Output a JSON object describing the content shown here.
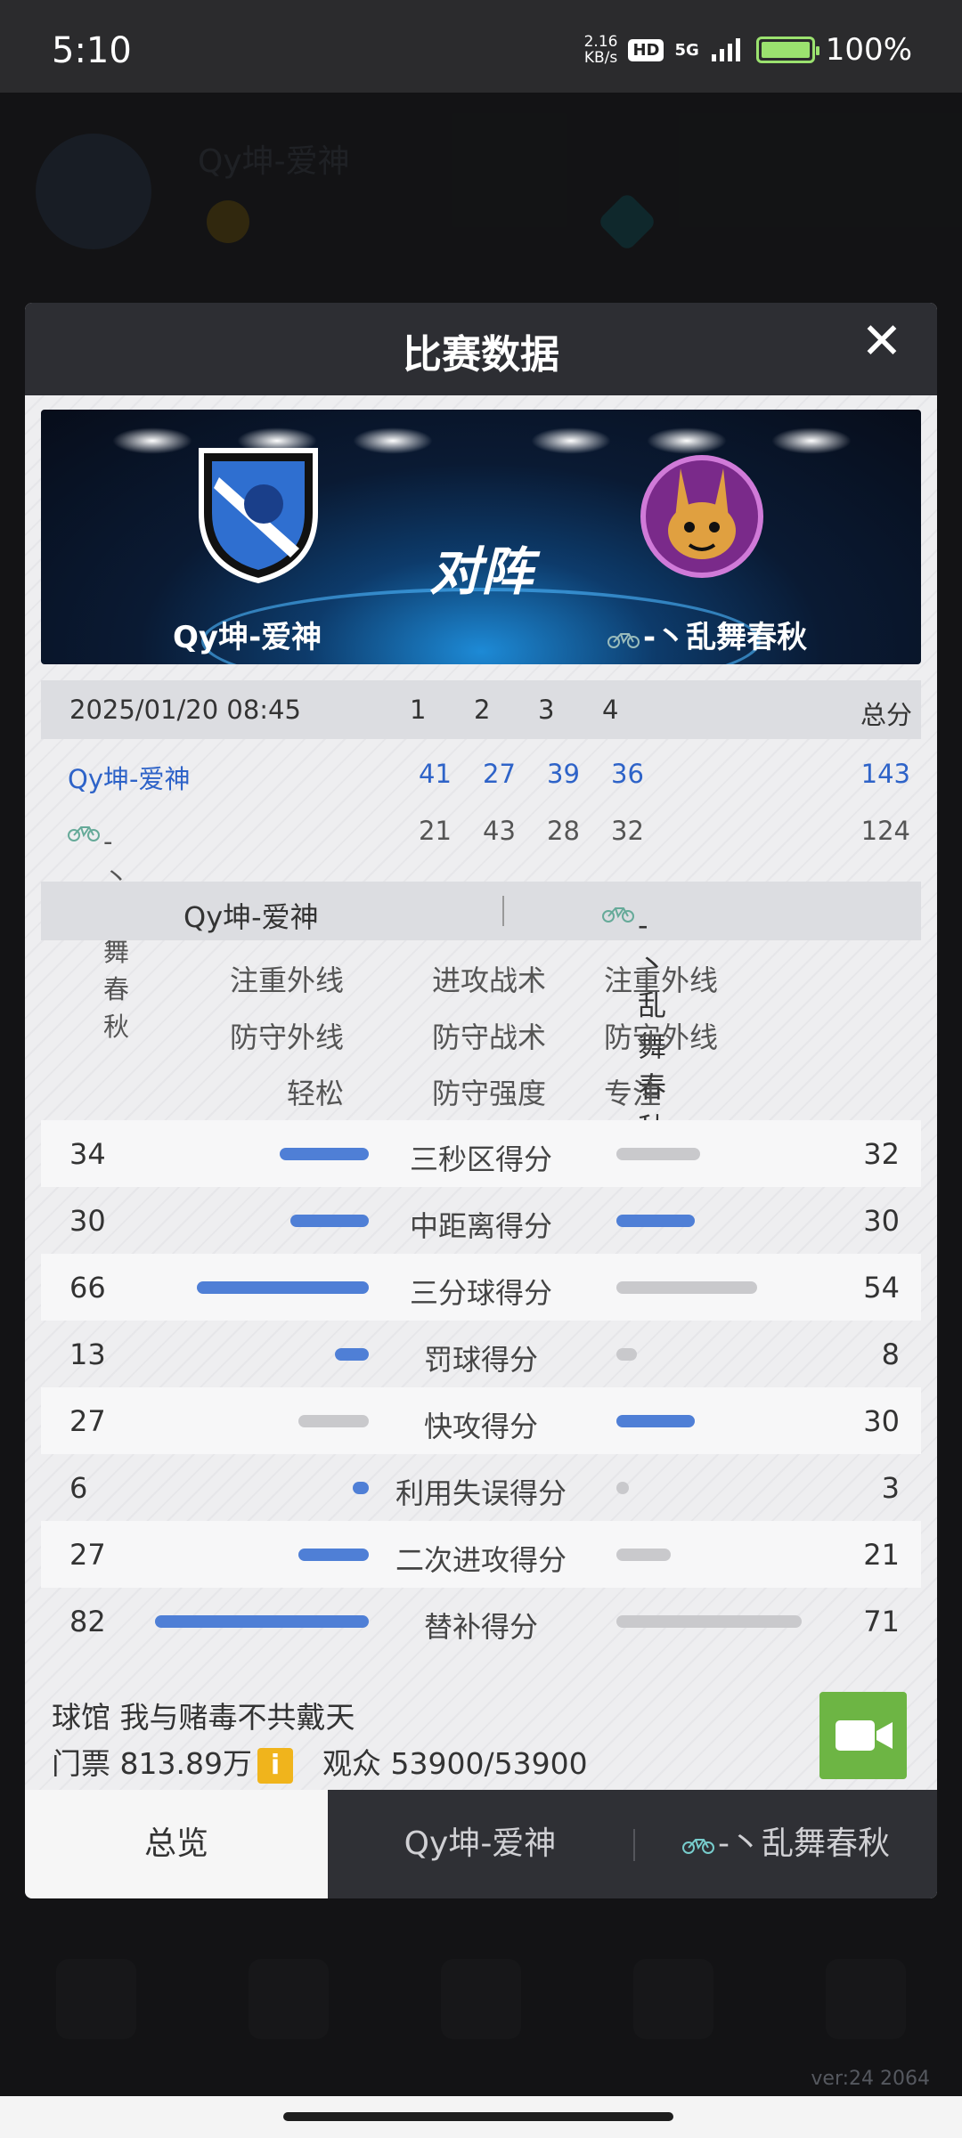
{
  "status_bar": {
    "time": "5:10",
    "net_speed_value": "2.16",
    "net_speed_unit": "KB/s",
    "hd": "HD",
    "network": "5G",
    "battery": "100%"
  },
  "background_app": {
    "team_name": "Qy坤-爱神",
    "version": "ver:24  2064"
  },
  "dialog": {
    "title": "比赛数据",
    "close_label": "✕",
    "vs_text": "对阵",
    "home_team": "Qy坤-爱神",
    "away_team": "-丶乱舞春秋"
  },
  "scoreboard": {
    "datetime": "2025/01/20 08:45",
    "quarters": [
      "1",
      "2",
      "3",
      "4"
    ],
    "total_label": "总分",
    "home": {
      "name": "Qy坤-爱神",
      "q": [
        "41",
        "27",
        "39",
        "36"
      ],
      "total": "143"
    },
    "away": {
      "name": "-丶乱舞春秋",
      "q": [
        "21",
        "43",
        "28",
        "32"
      ],
      "total": "124"
    }
  },
  "tactics": {
    "header_home": "Qy坤-爱神",
    "header_away": "-丶乱舞春秋",
    "rows": [
      {
        "home": "注重外线",
        "label": "进攻战术",
        "away": "注重外线"
      },
      {
        "home": "防守外线",
        "label": "防守战术",
        "away": "防守外线"
      },
      {
        "home": "轻松",
        "label": "防守强度",
        "away": "专注"
      }
    ]
  },
  "stats": [
    {
      "label": "三秒区得分",
      "home": 34,
      "away": 32
    },
    {
      "label": "中距离得分",
      "home": 30,
      "away": 30
    },
    {
      "label": "三分球得分",
      "home": 66,
      "away": 54
    },
    {
      "label": "罚球得分",
      "home": 13,
      "away": 8
    },
    {
      "label": "快攻得分",
      "home": 27,
      "away": 30
    },
    {
      "label": "利用失误得分",
      "home": 6,
      "away": 3
    },
    {
      "label": "二次进攻得分",
      "home": 27,
      "away": 21
    },
    {
      "label": "替补得分",
      "home": 82,
      "away": 71
    }
  ],
  "venue": {
    "arena_label": "球馆",
    "arena_name": "我与赌毒不共戴天",
    "ticket_label": "门票",
    "ticket_value": "813.89万",
    "info_icon": "i",
    "audience_label": "观众",
    "audience_value": "53900/53900"
  },
  "tabs": [
    {
      "label": "总览",
      "active": true
    },
    {
      "label": "Qy坤-爱神",
      "active": false
    },
    {
      "label": "-丶乱舞春秋",
      "active": false
    }
  ],
  "colors": {
    "win_bar": "#4f7fd6",
    "lose_bar": "#c9c9cc",
    "home_text": "#2e63c8",
    "video_button": "#6db544",
    "info_icon": "#f0b41c"
  }
}
